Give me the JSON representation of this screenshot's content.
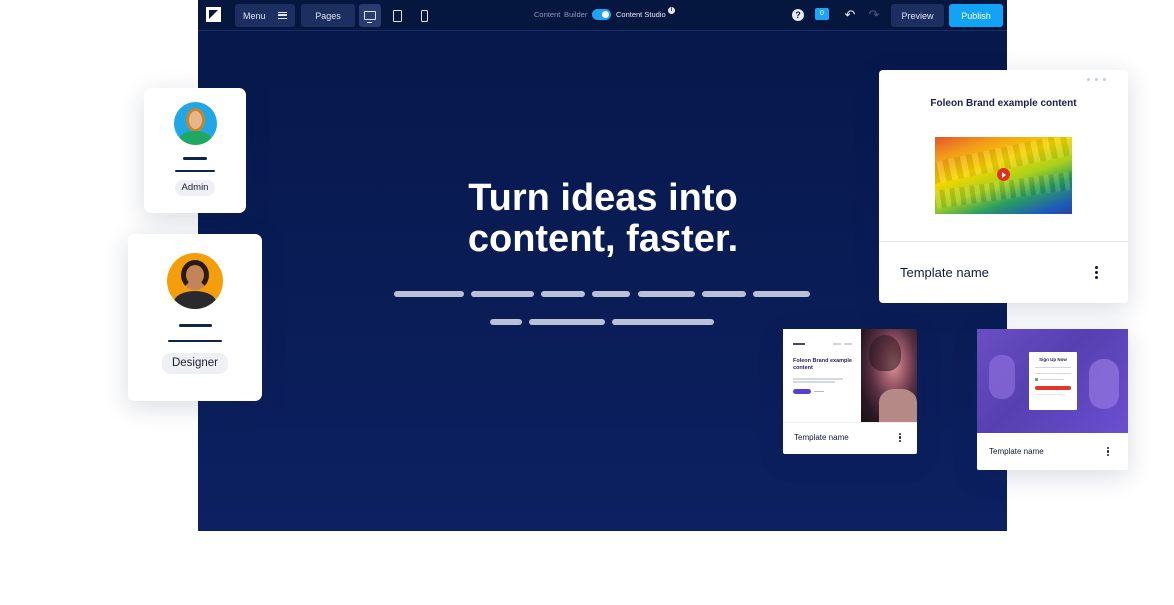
{
  "toolbar": {
    "menu_label": "Menu",
    "pages_label": "Pages",
    "mode_left": "Content",
    "mode_middle": "Builder",
    "mode_right": "Content Studio",
    "info_glyph": "i",
    "help_glyph": "?",
    "comments_count": "0",
    "undo_glyph": "↶",
    "redo_glyph": "↷",
    "preview_label": "Preview",
    "publish_label": "Publish"
  },
  "hero": {
    "title_line1": "Turn ideas into",
    "title_line2": "content, faster."
  },
  "users": [
    {
      "role": "Admin"
    },
    {
      "role": "Designer"
    }
  ],
  "templates": [
    {
      "heading": "Foleon Brand example content",
      "name": "Template name"
    },
    {
      "heading": "Foleon Brand example content",
      "name": "Template name"
    },
    {
      "heading": "Sign Up Now",
      "name": "Template name"
    }
  ],
  "colors": {
    "canvas": "#0a1d57",
    "accent": "#12a3f7",
    "admin_avatar_bg": "#22a6e6",
    "designer_avatar_bg": "#f59e0b"
  }
}
